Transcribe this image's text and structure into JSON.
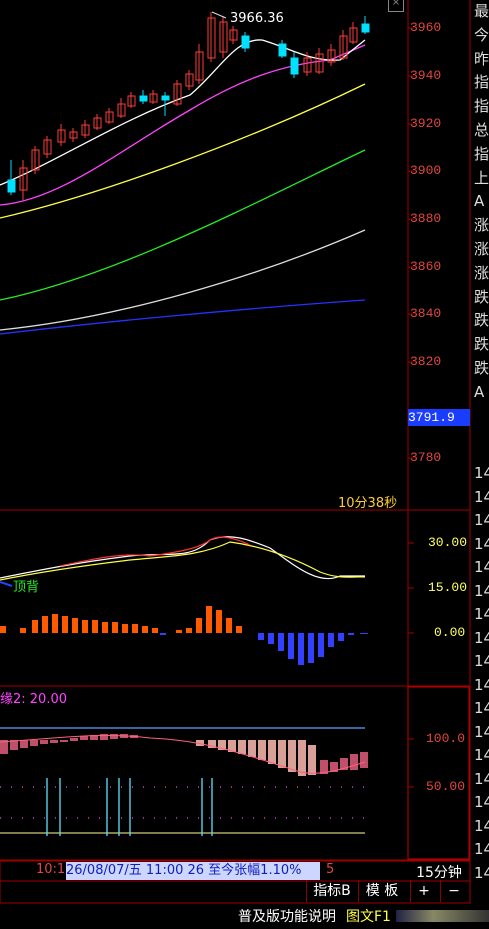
{
  "price_panel": {
    "axis_ticks": [
      "3960",
      "3940",
      "3920",
      "3900",
      "3880",
      "3860",
      "3840",
      "3820",
      "3780"
    ],
    "peak_label": "3966.36",
    "current_price": "3791.9",
    "countdown": "10分38秒"
  },
  "macd_panel": {
    "axis_ticks": [
      "30.00",
      "15.00",
      "0.00"
    ],
    "divergence_label": "顶背"
  },
  "lower_panel": {
    "indicator_label": "缘2: 20.00",
    "axis_ticks": [
      "100.0",
      "50.00"
    ]
  },
  "status_bar": {
    "time_left": "10:1",
    "info": "26/08/07/五 11:00 26 至今张幅1.10%",
    "tail": "5",
    "period": "15分钟"
  },
  "toolbar": {
    "indicator_button": "指标B",
    "template_button": "模 板",
    "plus_button": "+",
    "minus_button": "−"
  },
  "footer": {
    "help_link": "普及版功能说明",
    "chart_text_button": "图文F1"
  },
  "right_sidebar": {
    "top_chars": [
      "最",
      "今",
      "昨",
      "指",
      "指",
      "总",
      "指",
      "上",
      "A",
      "涨",
      "涨",
      "涨",
      "跌",
      "跌",
      "跌",
      "跌",
      "A"
    ],
    "numbers": [
      "14",
      "14",
      "14",
      "14",
      "14",
      "14",
      "14",
      "14",
      "14",
      "14",
      "14",
      "14",
      "14",
      "14",
      "14",
      "14",
      "14",
      "14"
    ]
  },
  "colors": {
    "axis_red": "#e0473f",
    "up_candle": "#ff3c3c",
    "down_candle": "#00e0ff",
    "ma5": "#ffffff",
    "ma10": "#ff44ff",
    "ma20": "#ffff44",
    "ma60": "#22ee22",
    "ma120": "#dddddd",
    "ma250": "#2233ff"
  }
}
